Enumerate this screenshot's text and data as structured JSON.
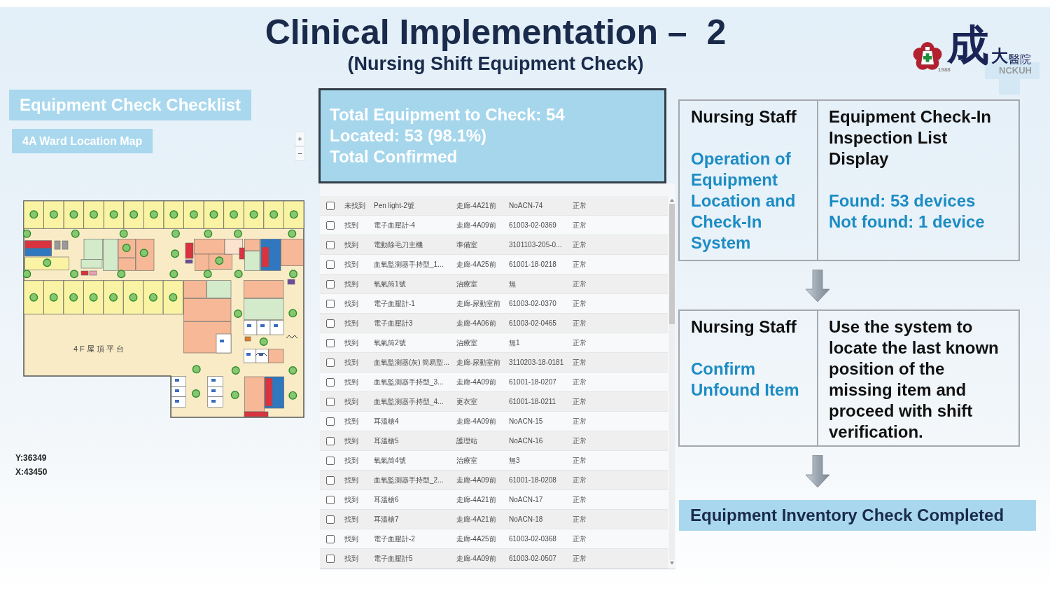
{
  "header": {
    "title": "Clinical Implementation –  2",
    "subtitle": "(Nursing Shift Equipment Check)"
  },
  "logo": {
    "year": "1988",
    "mark": "成",
    "name_big": "大",
    "name": "醫院",
    "abbreviation": "NCKUH"
  },
  "left_panel": {
    "heading": "Equipment Check Checklist",
    "map_title": "4A Ward Location Map",
    "zoom_controls": [
      "+",
      "−"
    ],
    "map_label": "4F屋頂平台",
    "coordinates": [
      "Y:36349",
      "X:43450"
    ]
  },
  "summary": {
    "lines": [
      "Total Equipment to Check: 54",
      "Located: 53 (98.1%)",
      "Total Confirmed"
    ]
  },
  "table": {
    "rows": [
      {
        "checked": false,
        "cells": [
          "未找到",
          "Pen light-2號",
          "走廊-4A21前",
          "NoACN-74",
          "正常"
        ]
      },
      {
        "checked": false,
        "cells": [
          "找到",
          "電子血壓計-4",
          "走廊-4A09前",
          "61003-02-0369",
          "正常"
        ]
      },
      {
        "checked": false,
        "cells": [
          "找到",
          "電動除毛刀主機",
          "準備室",
          "3101103-205-0...",
          "正常"
        ]
      },
      {
        "checked": false,
        "cells": [
          "找到",
          "血氧監測器手持型_1...",
          "走廊-4A25前",
          "61001-18-0218",
          "正常"
        ]
      },
      {
        "checked": false,
        "cells": [
          "找到",
          "氧氣筒1號",
          "治療室",
          "無",
          "正常"
        ]
      },
      {
        "checked": false,
        "cells": [
          "找到",
          "電子血壓計-1",
          "走廊-尿動室前",
          "61003-02-0370",
          "正常"
        ]
      },
      {
        "checked": false,
        "cells": [
          "找到",
          "電子血壓計3",
          "走廊-4A06前",
          "61003-02-0465",
          "正常"
        ]
      },
      {
        "checked": false,
        "cells": [
          "找到",
          "氧氣筒2號",
          "治療室",
          "無1",
          "正常"
        ]
      },
      {
        "checked": false,
        "cells": [
          "找到",
          "血氧監測器(灰) 簡易型...",
          "走廊-尿動室前",
          "3110203-18-0181",
          "正常"
        ]
      },
      {
        "checked": false,
        "cells": [
          "找到",
          "血氧監測器手持型_3...",
          "走廊-4A09前",
          "61001-18-0207",
          "正常"
        ]
      },
      {
        "checked": false,
        "cells": [
          "找到",
          "血氧監測器手持型_4...",
          "更衣室",
          "61001-18-0211",
          "正常"
        ]
      },
      {
        "checked": false,
        "cells": [
          "找到",
          "耳溫槍4",
          "走廊-4A09前",
          "NoACN-15",
          "正常"
        ]
      },
      {
        "checked": false,
        "cells": [
          "找到",
          "耳溫槍5",
          "護理站",
          "NoACN-16",
          "正常"
        ]
      },
      {
        "checked": false,
        "cells": [
          "找到",
          "氧氣筒4號",
          "治療室",
          "無3",
          "正常"
        ]
      },
      {
        "checked": false,
        "cells": [
          "找到",
          "血氧監測器手持型_2...",
          "走廊-4A09前",
          "61001-18-0208",
          "正常"
        ]
      },
      {
        "checked": false,
        "cells": [
          "找到",
          "耳溫槍6",
          "走廊-4A21前",
          "NoACN-17",
          "正常"
        ]
      },
      {
        "checked": false,
        "cells": [
          "找到",
          "耳溫槍7",
          "走廊-4A21前",
          "NoACN-18",
          "正常"
        ]
      },
      {
        "checked": false,
        "cells": [
          "找到",
          "電子血壓計-2",
          "走廊-4A25前",
          "61003-02-0368",
          "正常"
        ]
      },
      {
        "checked": false,
        "cells": [
          "找到",
          "電子血壓計5",
          "走廊-4A09前",
          "61003-02-0507",
          "正常"
        ]
      }
    ]
  },
  "flow": {
    "steps": [
      {
        "actor": "Nursing Staff",
        "action": "Operation of Equipment Location and Check-In System",
        "result": "Equipment Check-In Inspection List Display",
        "notes": [
          "Found: 53 devices",
          "Not found: 1 device"
        ]
      },
      {
        "actor": "Nursing Staff",
        "action": "Confirm Unfound Item",
        "result": "Use the system to locate the last known position of the missing item and proceed with shift verification."
      }
    ],
    "final": "Equipment Inventory Check Completed"
  }
}
